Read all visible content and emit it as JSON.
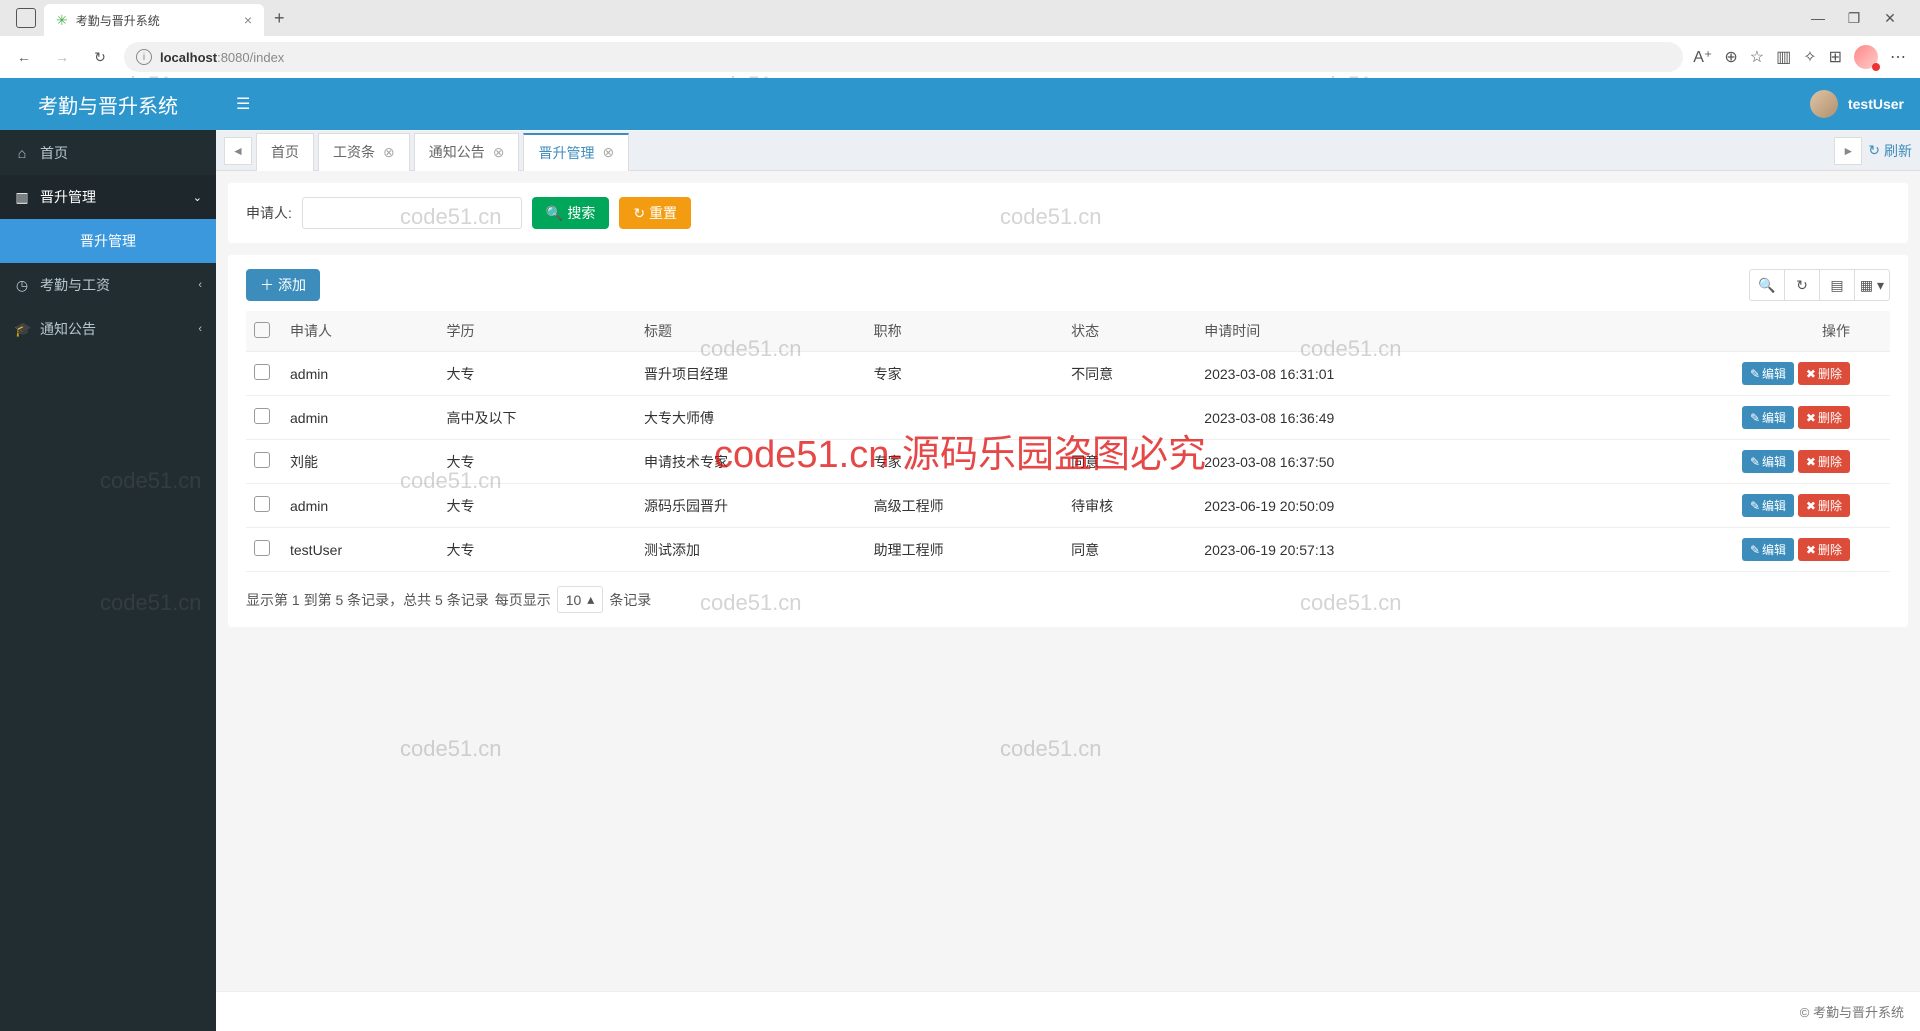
{
  "browser": {
    "tab_title": "考勤与晋升系统",
    "url_host": "localhost",
    "url_port_path": ":8080/index",
    "window_min": "—",
    "window_max": "❐",
    "window_close": "✕"
  },
  "header": {
    "app_title": "考勤与晋升系统",
    "username": "testUser"
  },
  "sidebar": {
    "home": "首页",
    "promotion_mgmt": "晋升管理",
    "promotion_sub": "晋升管理",
    "attendance_salary": "考勤与工资",
    "notice": "通知公告"
  },
  "tabs": {
    "home": "首页",
    "payslip": "工资条",
    "notice": "通知公告",
    "promotion": "晋升管理",
    "refresh": "刷新"
  },
  "filter": {
    "label": "申请人:",
    "search_btn": "搜索",
    "reset_btn": "重置"
  },
  "toolbar": {
    "add_btn": "添加"
  },
  "table": {
    "headers": {
      "applicant": "申请人",
      "education": "学历",
      "title": "标题",
      "job_title": "职称",
      "status": "状态",
      "apply_time": "申请时间",
      "ops": "操作"
    },
    "edit_btn": "编辑",
    "del_btn": "删除",
    "rows": [
      {
        "applicant": "admin",
        "education": "大专",
        "title": "晋升项目经理",
        "job_title": "专家",
        "status": "不同意",
        "apply_time": "2023-03-08 16:31:01"
      },
      {
        "applicant": "admin",
        "education": "高中及以下",
        "title": "大专大师傅",
        "job_title": "",
        "status": "",
        "apply_time": "2023-03-08 16:36:49"
      },
      {
        "applicant": "刘能",
        "education": "大专",
        "title": "申请技术专家",
        "job_title": "专家",
        "status": "同意",
        "apply_time": "2023-03-08 16:37:50"
      },
      {
        "applicant": "admin",
        "education": "大专",
        "title": "源码乐园晋升",
        "job_title": "高级工程师",
        "status": "待审核",
        "apply_time": "2023-06-19 20:50:09"
      },
      {
        "applicant": "testUser",
        "education": "大专",
        "title": "测试添加",
        "job_title": "助理工程师",
        "status": "同意",
        "apply_time": "2023-06-19 20:57:13"
      }
    ]
  },
  "pagination": {
    "prefix": "显示第 1 到第 5 条记录，总共 5 条记录",
    "per_page_label": "每页显示",
    "page_size": "10",
    "suffix": "条记录"
  },
  "footer": {
    "copyright": "© 考勤与晋升系统"
  },
  "watermark": {
    "text": "code51.cn",
    "big": "code51.cn-源码乐园盗图必究"
  }
}
